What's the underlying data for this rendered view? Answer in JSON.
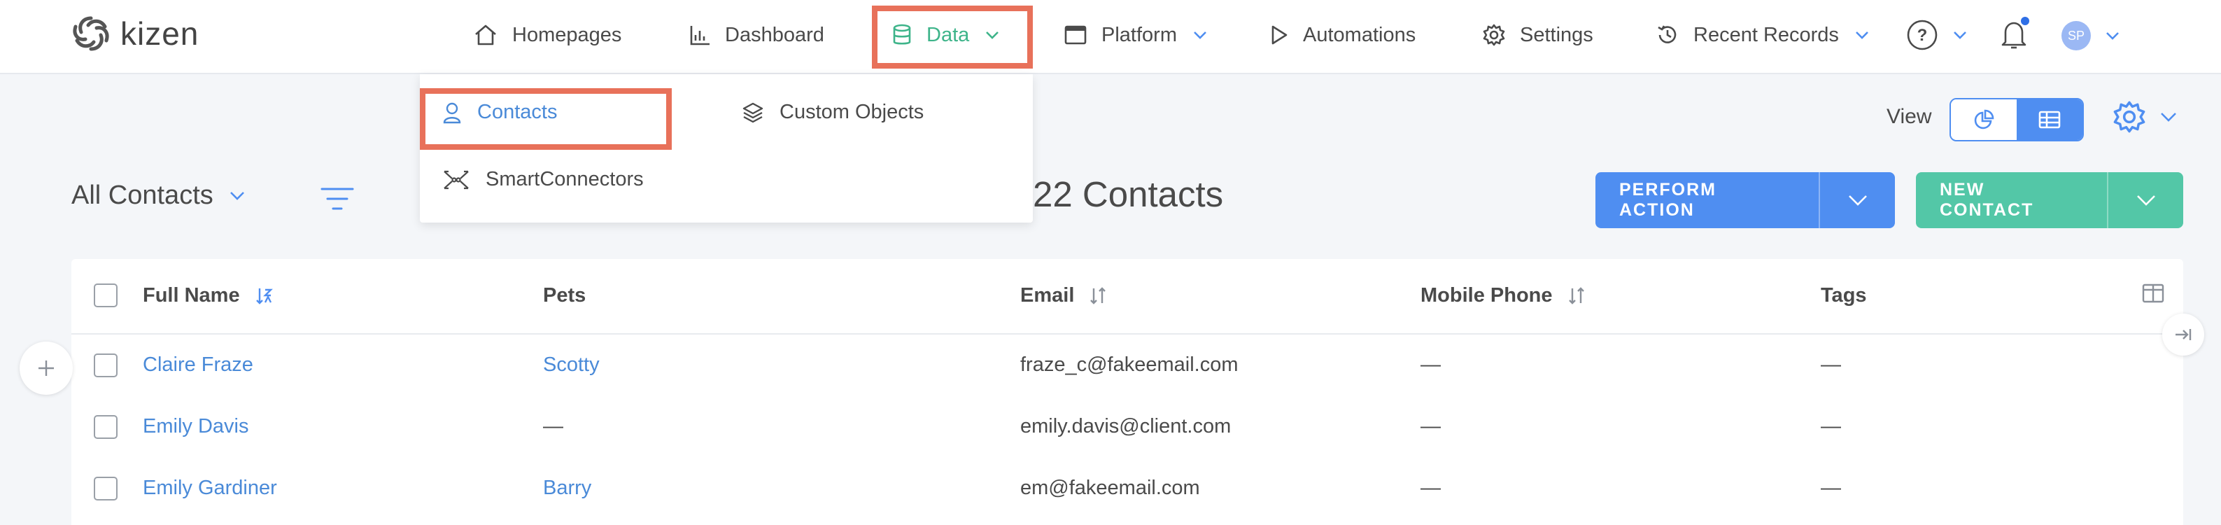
{
  "brand": {
    "name": "kizen"
  },
  "nav": {
    "items": [
      {
        "label": "Homepages",
        "icon": "home-icon"
      },
      {
        "label": "Dashboard",
        "icon": "bar-chart-icon"
      },
      {
        "label": "Data",
        "icon": "database-icon",
        "active": true
      },
      {
        "label": "Platform",
        "icon": "window-icon"
      },
      {
        "label": "Automations",
        "icon": "play-icon"
      },
      {
        "label": "Settings",
        "icon": "gear-icon"
      },
      {
        "label": "Recent Records",
        "icon": "history-icon"
      }
    ],
    "user_initials": "SP"
  },
  "data_menu": {
    "contacts": "Contacts",
    "custom_objects": "Custom Objects",
    "smart_connectors": "SmartConnectors"
  },
  "toolbar": {
    "group_label": "All Contacts",
    "count_label": "22 Contacts",
    "view_label": "View",
    "perform_action": "PERFORM ACTION",
    "new_contact": "NEW CONTACT"
  },
  "table": {
    "columns": [
      "Full Name",
      "Pets",
      "Email",
      "Mobile Phone",
      "Tags"
    ],
    "rows": [
      {
        "name": "Claire Fraze",
        "pets": "Scotty",
        "email": "fraze_c@fakeemail.com",
        "mobile": "—",
        "tags": "—"
      },
      {
        "name": "Emily Davis",
        "pets": "—",
        "email": "emily.davis@client.com",
        "mobile": "—",
        "tags": "—"
      },
      {
        "name": "Emily Gardiner",
        "pets": "Barry",
        "email": "em@fakeemail.com",
        "mobile": "—",
        "tags": "—"
      }
    ]
  },
  "colors": {
    "accent_blue": "#4f8ef1",
    "accent_green": "#53c7a7",
    "active_nav_green": "#3eb48a",
    "link_blue": "#4a8ad8",
    "highlight_red": "#e8715a"
  }
}
